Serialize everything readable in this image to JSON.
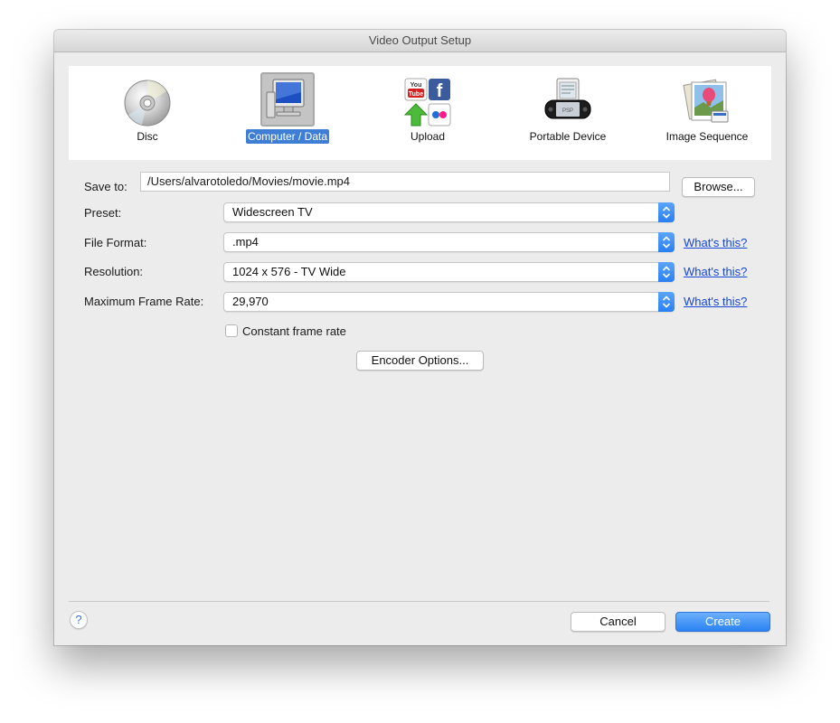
{
  "window": {
    "title": "Video Output Setup"
  },
  "toolbar": {
    "items": [
      {
        "label": "Disc",
        "icon": "disc-icon",
        "selected": false
      },
      {
        "label": "Computer / Data",
        "icon": "computer-icon",
        "selected": true
      },
      {
        "label": "Upload",
        "icon": "upload-icon",
        "selected": false
      },
      {
        "label": "Portable Device",
        "icon": "portable-device-icon",
        "selected": false
      },
      {
        "label": "Image Sequence",
        "icon": "image-sequence-icon",
        "selected": false
      }
    ]
  },
  "form": {
    "save_to_label": "Save to:",
    "save_to_value": "/Users/alvarotoledo/Movies/movie.mp4",
    "browse_label": "Browse...",
    "preset_label": "Preset:",
    "preset_value": "Widescreen TV",
    "file_format_label": "File Format:",
    "file_format_value": ".mp4",
    "resolution_label": "Resolution:",
    "resolution_value": "1024 x 576 - TV Wide",
    "frame_rate_label": "Maximum Frame Rate:",
    "frame_rate_value": "29,970",
    "whats_this": "What's this?",
    "constant_frame_rate_label": "Constant frame rate",
    "constant_frame_rate_checked": false,
    "encoder_options_label": "Encoder Options..."
  },
  "footer": {
    "help_symbol": "?",
    "cancel_label": "Cancel",
    "create_label": "Create"
  },
  "colors": {
    "accent": "#2b82f3",
    "selection": "#3e7ed4",
    "link": "#1546d6"
  }
}
